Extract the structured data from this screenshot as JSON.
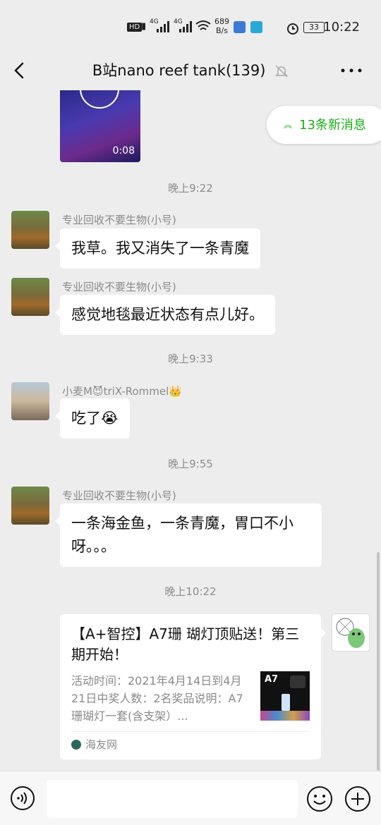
{
  "status_bar": {
    "hd": "HD",
    "signal1": "4G",
    "signal2": "4G",
    "speed_value": "689",
    "speed_unit": "B/s",
    "battery": "33",
    "time": "10:22"
  },
  "nav": {
    "title": "B站nano reef tank(139)"
  },
  "video": {
    "duration": "0:08"
  },
  "new_messages": {
    "label": "13条新消息"
  },
  "messages": [
    {
      "time": "晚上9:22"
    },
    {
      "sender": "专业回收不要生物(小号)",
      "text": "我草。我又消失了一条青魔"
    },
    {
      "sender": "专业回收不要生物(小号)",
      "text": "感觉地毯最近状态有点儿好。"
    },
    {
      "time": "晚上9:33"
    },
    {
      "sender": "小麦M😈triX-Rommel👑",
      "text": "吃了😭"
    },
    {
      "time": "晚上9:55"
    },
    {
      "sender": "专业回收不要生物(小号)",
      "text_line1": "一条海金鱼，一条青魔，胃口不小",
      "text_line2": "呀。。。"
    },
    {
      "time": "晚上10:22"
    }
  ],
  "card": {
    "title": "【A+智控】A7珊 瑚灯顶贴送！第三期开始！",
    "desc": "活动时间：2021年4月14日到4月21日中奖人数：2名奖品说明：A7珊瑚灯一套(含支架）...",
    "thumb_label": "A7",
    "source": "海友网"
  },
  "input": {
    "placeholder": ""
  },
  "colors": {
    "accent_green": "#1aad19",
    "bg": "#ededed"
  }
}
